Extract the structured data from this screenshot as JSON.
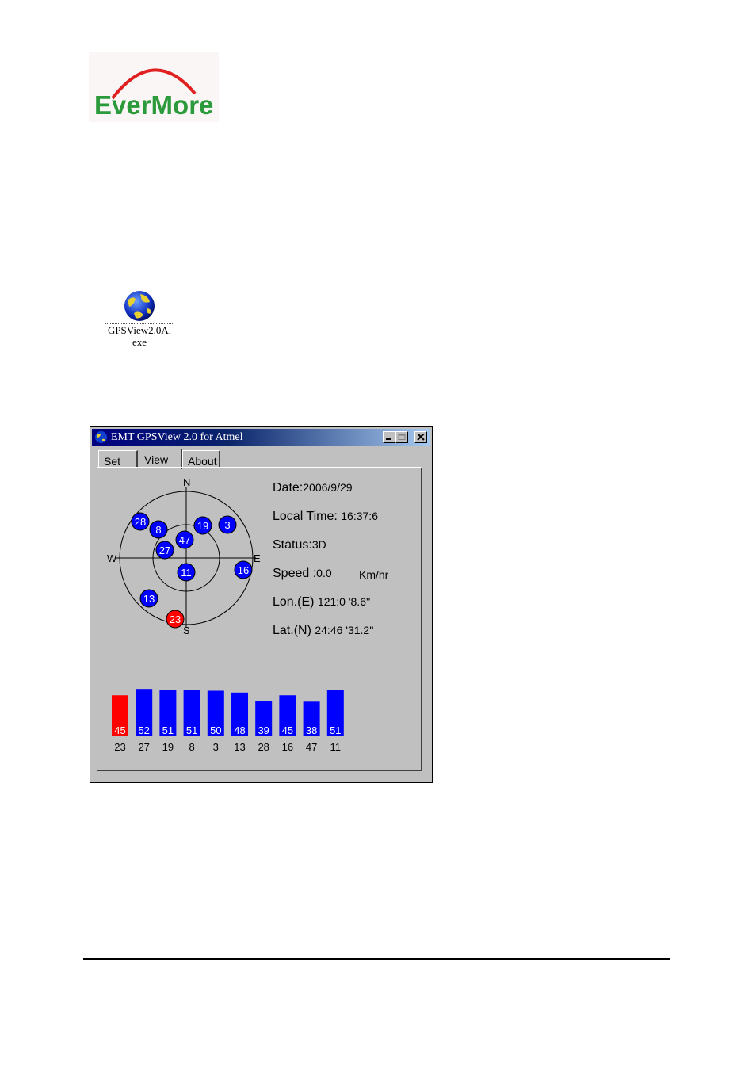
{
  "logo": {
    "text": "EverMore"
  },
  "desktop_icon": {
    "icon": "globe-icon",
    "label_line1": "GPSView2.0A.",
    "label_line2": "exe"
  },
  "window": {
    "title": "EMT GPSView 2.0 for Atmel",
    "tabs": [
      "Set",
      "View",
      "About"
    ],
    "active_tab": "View"
  },
  "compass": {
    "north": "N",
    "south": "S",
    "east": "E",
    "west": "W"
  },
  "info": {
    "date_label": "Date:",
    "date_value": "2006/9/29",
    "time_label": "Local Time:",
    "time_value": "16:37:6",
    "status_label": "Status:",
    "status_value": "3D",
    "speed_label": "Speed :",
    "speed_value": "0.0",
    "speed_unit": "Km/hr",
    "lon_label": "Lon.(E)",
    "lon_value": "121:0 '8.6''",
    "lat_label": "Lat.(N)",
    "lat_value": "24:46 '31.2''"
  },
  "colors": {
    "satellite_used": "#0000ff",
    "satellite_weak": "#ff0000"
  },
  "sky_satellites": [
    {
      "id": "28",
      "color": "blue"
    },
    {
      "id": "8",
      "color": "blue"
    },
    {
      "id": "19",
      "color": "blue"
    },
    {
      "id": "3",
      "color": "blue"
    },
    {
      "id": "47",
      "color": "blue"
    },
    {
      "id": "27",
      "color": "blue"
    },
    {
      "id": "11",
      "color": "blue"
    },
    {
      "id": "16",
      "color": "blue"
    },
    {
      "id": "13",
      "color": "blue"
    },
    {
      "id": "23",
      "color": "red"
    }
  ],
  "chart_data": {
    "type": "bar",
    "categories": [
      "23",
      "27",
      "19",
      "8",
      "3",
      "13",
      "28",
      "16",
      "47",
      "11"
    ],
    "values": [
      45,
      52,
      51,
      51,
      50,
      48,
      39,
      45,
      38,
      51
    ],
    "bar_colors": [
      "red",
      "blue",
      "blue",
      "blue",
      "blue",
      "blue",
      "blue",
      "blue",
      "blue",
      "blue"
    ]
  }
}
